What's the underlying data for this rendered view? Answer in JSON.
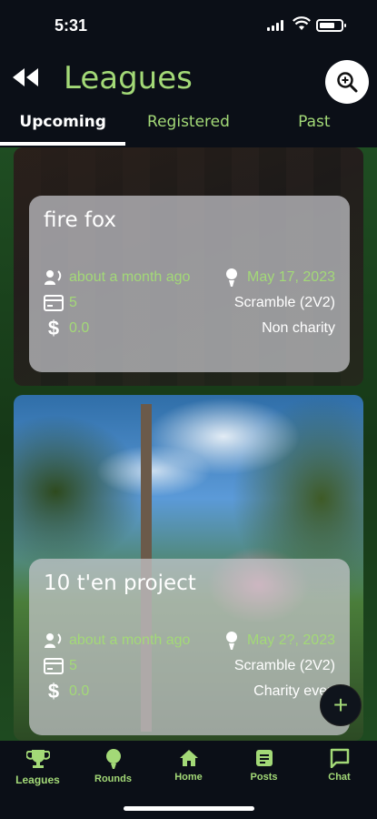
{
  "status_bar": {
    "time": "5:31"
  },
  "header": {
    "title": "Leagues",
    "back_icon": "rewind-icon",
    "search_icon": "search-zoom-icon"
  },
  "tabs": [
    {
      "label": "Upcoming",
      "active": true
    },
    {
      "label": "Registered",
      "active": false
    },
    {
      "label": "Past",
      "active": false
    }
  ],
  "leagues": [
    {
      "name": "fire fox",
      "created": "about a month ago",
      "date": "May 17, 2023",
      "slots": "5",
      "format": "Scramble (2V2)",
      "fee": "0.0",
      "charity": "Non charity"
    },
    {
      "name": "10 t'en project",
      "created": "about a month ago",
      "date": "May 2?, 2023",
      "slots": "5",
      "format": "Scramble (2V2)",
      "fee": "0.0",
      "charity": "Charity even"
    }
  ],
  "fab": {
    "label": "+"
  },
  "bottom_nav": [
    {
      "label": "Leagues",
      "icon": "trophy-icon",
      "active": true
    },
    {
      "label": "Rounds",
      "icon": "golf-ball-icon",
      "active": false
    },
    {
      "label": "Home",
      "icon": "home-icon",
      "active": false
    },
    {
      "label": "Posts",
      "icon": "posts-icon",
      "active": false
    },
    {
      "label": "Chat",
      "icon": "chat-icon",
      "active": false
    }
  ],
  "colors": {
    "accent": "#a3d977",
    "background": "#0b0f17",
    "card_glass": "#c8c8cd"
  }
}
